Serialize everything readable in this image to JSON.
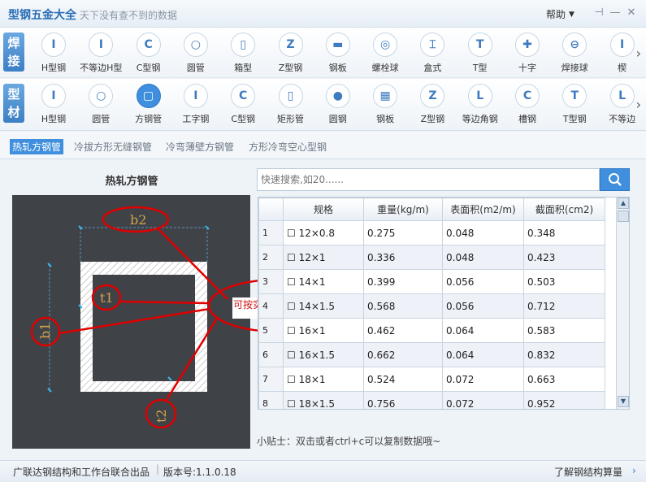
{
  "app": {
    "title": "型钢五金大全",
    "subtitle": "天下没有查不到的数据",
    "help_label": "帮助",
    "controls": [
      "pin-icon",
      "minimize-icon",
      "close-icon"
    ]
  },
  "row1": {
    "tag": "焊接",
    "items": [
      "H型钢",
      "不等边H型",
      "C型钢",
      "圆管",
      "箱型",
      "Z型钢",
      "钢板",
      "螺栓球",
      "盒式",
      "T型",
      "十字",
      "焊接球",
      "楔"
    ]
  },
  "row2": {
    "tag": "型材",
    "items": [
      "H型钢",
      "圆管",
      "方钢管",
      "工字钢",
      "C型钢",
      "矩形管",
      "圆钢",
      "钢板",
      "Z型钢",
      "等边角钢",
      "槽钢",
      "T型钢",
      "不等边"
    ],
    "active_index": 2
  },
  "subtabs": [
    "热轧方钢管",
    "冷拔方形无缝钢管",
    "冷弯薄壁方钢管",
    "方形冷弯空心型钢"
  ],
  "left_panel": {
    "title": "热轧方钢管",
    "labels": {
      "b2": "b2",
      "t1": "t1",
      "b1": "b1",
      "t2": "t2"
    }
  },
  "search": {
    "placeholder": "快速搜索,如20......"
  },
  "table": {
    "headers": [
      "规格",
      "重量(kg/m)",
      "表面积(m2/m)",
      "截面积(cm2)"
    ],
    "rows": [
      [
        "1",
        "☐ 12×0.8",
        "0.275",
        "0.048",
        "0.348"
      ],
      [
        "2",
        "☐ 12×1",
        "0.336",
        "0.048",
        "0.423"
      ],
      [
        "3",
        "☐ 14×1",
        "0.399",
        "0.056",
        "0.503"
      ],
      [
        "4",
        "☐ 14×1.5",
        "0.568",
        "0.056",
        "0.712"
      ],
      [
        "5",
        "☐ 16×1",
        "0.462",
        "0.064",
        "0.583"
      ],
      [
        "6",
        "☐ 16×1.5",
        "0.662",
        "0.064",
        "0.832"
      ],
      [
        "7",
        "☐ 18×1",
        "0.524",
        "0.072",
        "0.663"
      ],
      [
        "8",
        "☐ 18×1.5",
        "0.756",
        "0.072",
        "0.952"
      ]
    ]
  },
  "annotation": "可按实际修改数据",
  "tip": "小贴士：双击或者ctrl+c可以复制数据哦~",
  "status": {
    "publisher": "广联达钢结构和工作台联合出品",
    "version": "版本号:1.1.0.18",
    "link": "了解钢结构算量"
  },
  "colors": {
    "accent": "#3f8fde",
    "annotation": "#e00000",
    "diagram_bg": "#3f4348"
  }
}
